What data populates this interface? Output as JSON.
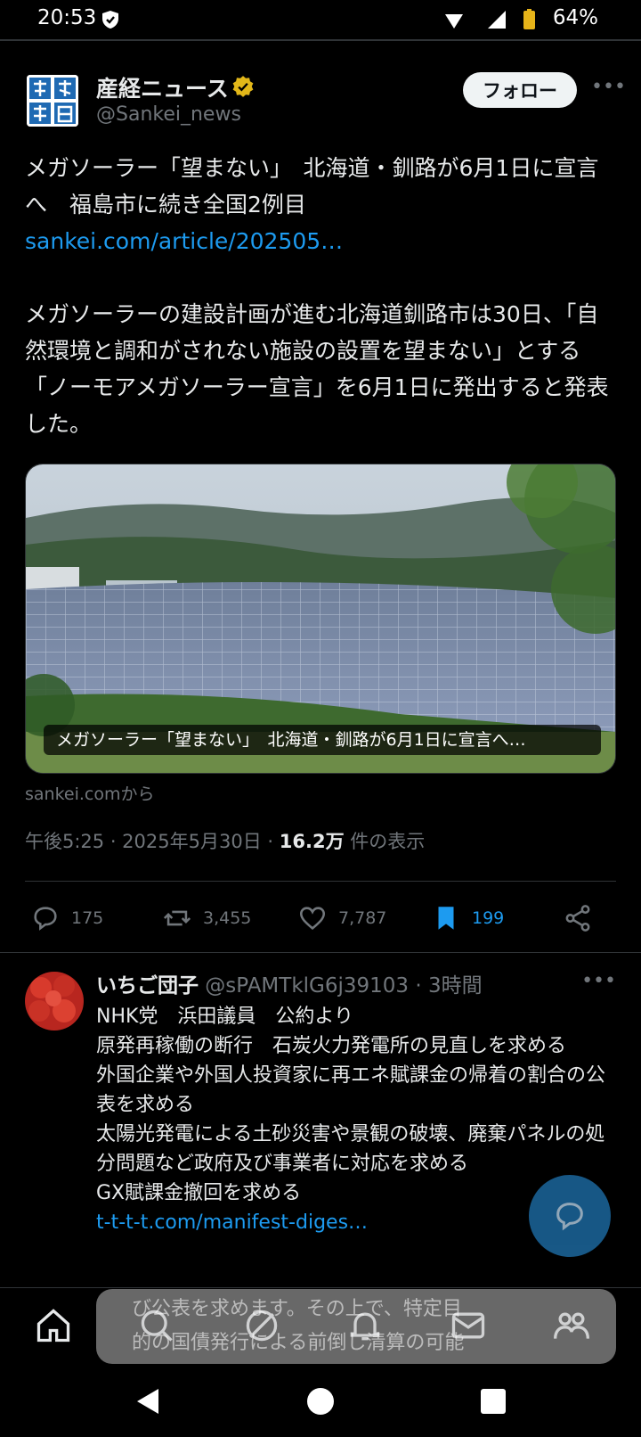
{
  "status": {
    "time": "20:53",
    "battery": "64%"
  },
  "post": {
    "author_name": "産経ニュース",
    "author_handle": "@Sankei_news",
    "follow_label": "フォロー",
    "title_text": "メガソーラー「望まない」　北海道・釧路が6月1日に宣言へ　福島市に続き全国2例目",
    "link_text": "sankei.com/article/202505…",
    "body_text": "メガソーラーの建設計画が進む北海道釧路市は30日、「自然環境と調和がされない施設の設置を望まない」とする「ノーモアメガソーラー宣言」を6月1日に発出すると発表した。",
    "card_caption": "メガソーラー「望まない」　北海道・釧路が6月1日に宣言へ…",
    "card_source": "sankei.comから",
    "time": "午後5:25 · 2025年5月30日 · ",
    "views_count": "16.2万",
    "views_label": " 件の表示",
    "actions": {
      "replies": "175",
      "reposts": "3,455",
      "likes": "7,787",
      "bookmarks": "199"
    }
  },
  "reply": {
    "name": "いちご団子",
    "handle": " @sPAMTklG6j39103",
    "time": " · 3時間",
    "lines": [
      "NHK党　浜田議員　公約より",
      "原発再稼働の断行　石炭火力発電所の見直しを求める",
      "外国企業や外国人投資家に再エネ賦課金の帰着の割合の公表を求める",
      "太陽光発電による土砂災害や景観の破壊、廃棄パネルの処分問題など政府及び事業者に対応を求める",
      "GX賦課金撤回を求める"
    ],
    "link_text": "t-t-t-t.com/manifest-diges…"
  },
  "overlay": {
    "line1": "び公表を求めます。その上で、特定目",
    "line2": "的の国債発行による前倒し清算の可能"
  },
  "colors": {
    "accent": "#1d9bf0",
    "verified": "#e2b719"
  }
}
